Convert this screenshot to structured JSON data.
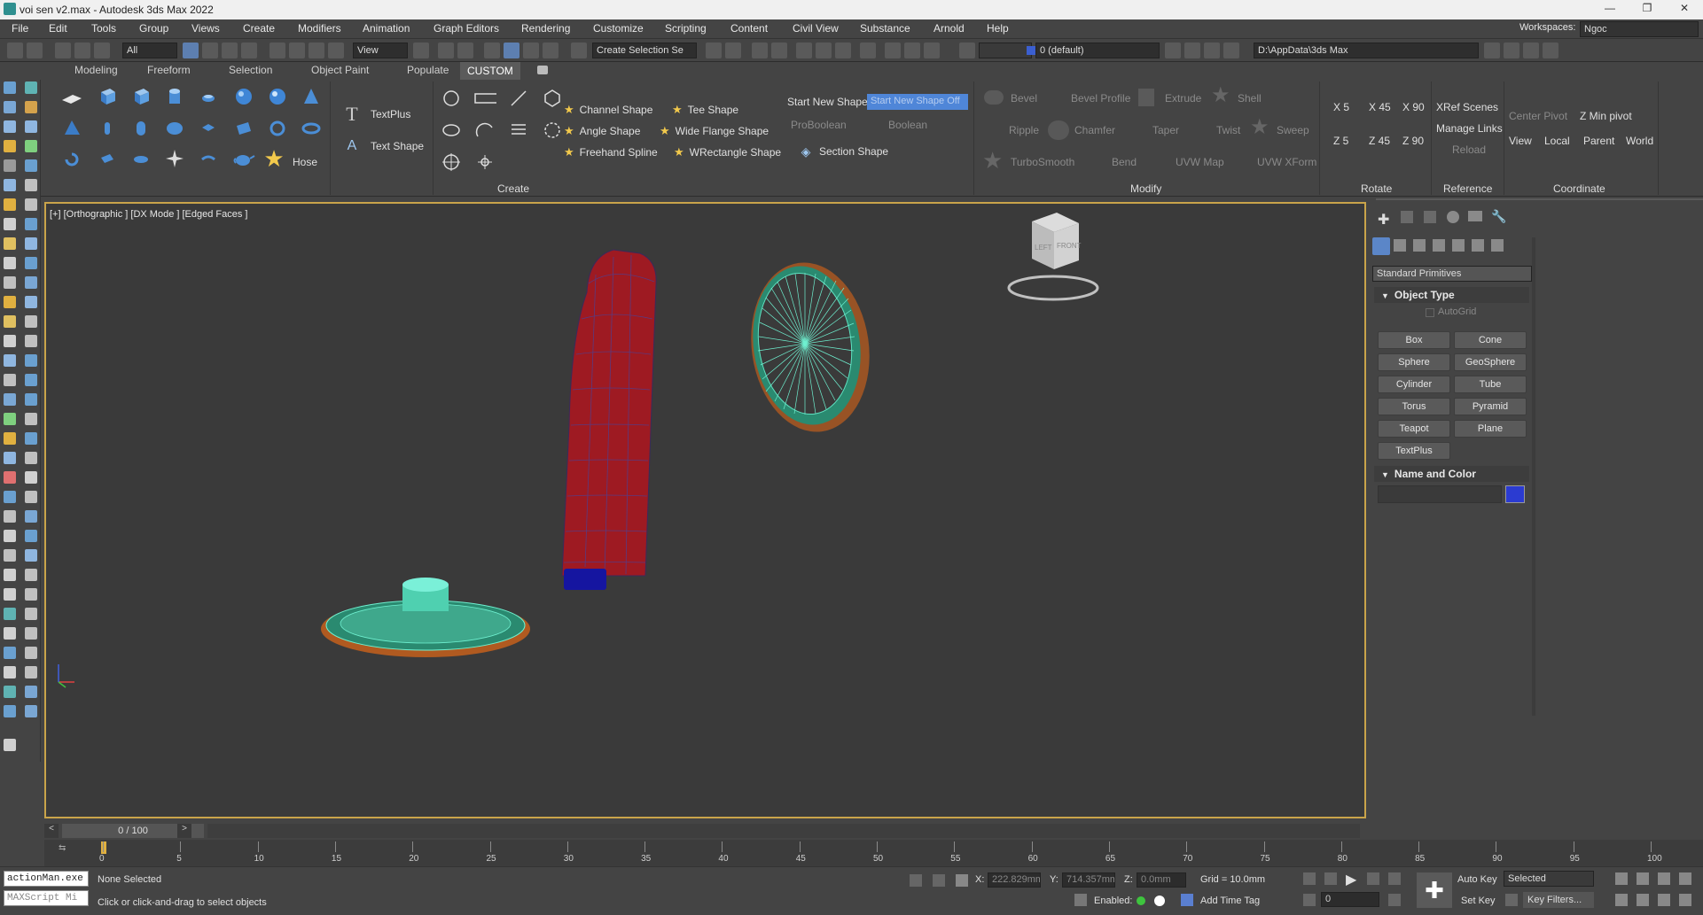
{
  "window": {
    "title": "voi sen v2.max - Autodesk 3ds Max 2022",
    "minimize": "—",
    "maximize": "❐",
    "close": "✕"
  },
  "menu": [
    "File",
    "Edit",
    "Tools",
    "Group",
    "Views",
    "Create",
    "Modifiers",
    "Animation",
    "Graph Editors",
    "Rendering",
    "Customize",
    "Scripting",
    "Content",
    "Civil View",
    "Substance",
    "Arnold",
    "Help"
  ],
  "workspaces": {
    "label": "Workspaces:",
    "value": "Ngoc"
  },
  "toolbar": {
    "filter": "All",
    "ref_coord": "View",
    "selection_set": "Create Selection Se",
    "layer": "0 (default)",
    "path": "D:\\AppData\\3ds Max"
  },
  "ribbon_tabs": [
    "Modeling",
    "Freeform",
    "Selection",
    "Object Paint",
    "Populate",
    "CUSTOM"
  ],
  "ribbon": {
    "textplus": "TextPlus",
    "text_shape": "Text Shape",
    "hose": "Hose",
    "channel_shape": "Channel Shape",
    "tee_shape": "Tee Shape",
    "angle_shape": "Angle Shape",
    "wide_flange_shape": "Wide Flange Shape",
    "freehand_spline": "Freehand Spline",
    "wrectangle_shape": "WRectangle Shape",
    "start_new_shape": "Start New Shape",
    "start_new_shape_box": "Start New Shape Off",
    "proboolean": "ProBoolean",
    "boolean": "Boolean",
    "section_shape": "Section Shape",
    "bevel": "Bevel",
    "bevel_profile": "Bevel Profile",
    "extrude": "Extrude",
    "shell": "Shell",
    "ripple": "Ripple",
    "chamfer": "Chamfer",
    "taper": "Taper",
    "twist": "Twist",
    "sweep": "Sweep",
    "turbosmooth": "TurboSmooth",
    "bend": "Bend",
    "uvw_map": "UVW Map",
    "uvw_xform": "UVW XForm",
    "x5": "X 5",
    "x45": "X 45",
    "x90": "X 90",
    "z5": "Z 5",
    "z45": "Z 45",
    "z90": "Z 90",
    "xref_scenes": "XRef Scenes",
    "manage_links": "Manage Links",
    "reload": "Reload",
    "center_pivot": "Center Pivot",
    "zmin_pivot": "Z Min pivot",
    "view": "View",
    "local": "Local",
    "parent": "Parent",
    "world": "World",
    "panel_create": "Create",
    "panel_modify": "Modify",
    "panel_rotate": "Rotate",
    "panel_reference": "Reference",
    "panel_coordinate": "Coordinate"
  },
  "viewport": {
    "label": "[+] [Orthographic ] [DX Mode ] [Edged Faces ]",
    "cube_left": "LEFT",
    "cube_front": "FRONT"
  },
  "cmd": {
    "category": "Standard Primitives",
    "object_type": "Object Type",
    "autogrid": "AutoGrid",
    "buttons": [
      "Box",
      "Cone",
      "Sphere",
      "GeoSphere",
      "Cylinder",
      "Tube",
      "Torus",
      "Pyramid",
      "Teapot",
      "Plane",
      "TextPlus"
    ],
    "name_and_color": "Name and Color",
    "color": "#2b3bd1"
  },
  "timeline": {
    "frame": "0 / 100",
    "prev": "<",
    "next": ">",
    "ticks": [
      "0",
      "5",
      "10",
      "15",
      "20",
      "25",
      "30",
      "35",
      "40",
      "45",
      "50",
      "55",
      "60",
      "65",
      "70",
      "75",
      "80",
      "85",
      "90",
      "95",
      "100"
    ]
  },
  "status": {
    "script1": "actionMan.exe",
    "script2": "MAXScript Mi",
    "selected": "None Selected",
    "prompt": "Click or click-and-drag to select objects",
    "x_label": "X:",
    "x": "222.829mm",
    "y_label": "Y:",
    "y": "714.357mm",
    "z_label": "Z:",
    "z": "0.0mm",
    "grid": "Grid = 10.0mm",
    "enabled": "Enabled:",
    "add_time_tag": "Add Time Tag",
    "auto_key": "Auto Key",
    "set_key": "Set Key",
    "selected_dd": "Selected",
    "key_filters": "Key Filters...",
    "frame_field": "0"
  }
}
